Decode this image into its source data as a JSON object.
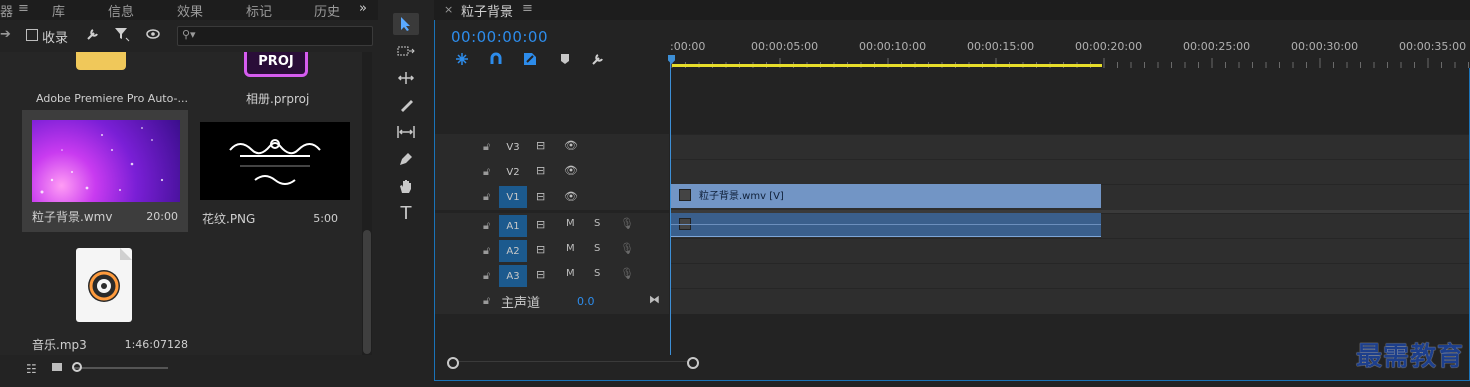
{
  "project_panel": {
    "tabs": [
      "器",
      "库",
      "信息",
      "效果",
      "标记",
      "历史"
    ],
    "more_glyph": "»",
    "collect_checkbox_label": "收录",
    "search": {
      "placeholder": "",
      "icon": "search-icon"
    },
    "items": [
      {
        "name": "Adobe Premiere Pro Auto-...",
        "duration": "",
        "thumb": "folder-icon"
      },
      {
        "name": "相册.prproj",
        "duration": "",
        "thumb": "proj-file-icon",
        "badge": "PROJ"
      },
      {
        "name": "粒子背景.wmv",
        "duration": "20:00",
        "thumb": "purple-particles",
        "selected": true
      },
      {
        "name": "花纹.PNG",
        "duration": "5:00",
        "thumb": "ornament-image"
      },
      {
        "name": "音乐.mp3",
        "duration": "1:46:07128",
        "thumb": "audio-file-icon"
      }
    ]
  },
  "tools": [
    "selection-tool",
    "track-select-tool",
    "ripple-edit-tool",
    "razor-tool",
    "slip-tool",
    "pen-tool",
    "hand-tool",
    "type-tool"
  ],
  "timeline": {
    "sequence_name": "粒子背景",
    "menu_glyph": "≡",
    "close_glyph": "×",
    "timecode": "00:00:00:00",
    "ruler_labels": [
      ":00:00",
      "00:00:05:00",
      "00:00:10:00",
      "00:00:15:00",
      "00:00:20:00",
      "00:00:25:00",
      "00:00:30:00",
      "00:00:35:00"
    ],
    "tracks": {
      "video": [
        {
          "label": "V3",
          "targeted": false
        },
        {
          "label": "V2",
          "targeted": false
        },
        {
          "label": "V1",
          "targeted": true
        }
      ],
      "audio": [
        {
          "label": "A1",
          "m": "M",
          "s": "S"
        },
        {
          "label": "A2",
          "m": "M",
          "s": "S"
        },
        {
          "label": "A3",
          "m": "M",
          "s": "S"
        }
      ],
      "master": {
        "label": "主声道",
        "value": "0.0"
      }
    },
    "clips": {
      "video_clip": "粒子背景.wmv [V]"
    }
  },
  "watermark": "最需教育",
  "colors": {
    "accent": "#2d8ceb",
    "work_area": "#e6dd2a",
    "video_clip": "#7295c5",
    "audio_clip": "#3a5f8c"
  }
}
